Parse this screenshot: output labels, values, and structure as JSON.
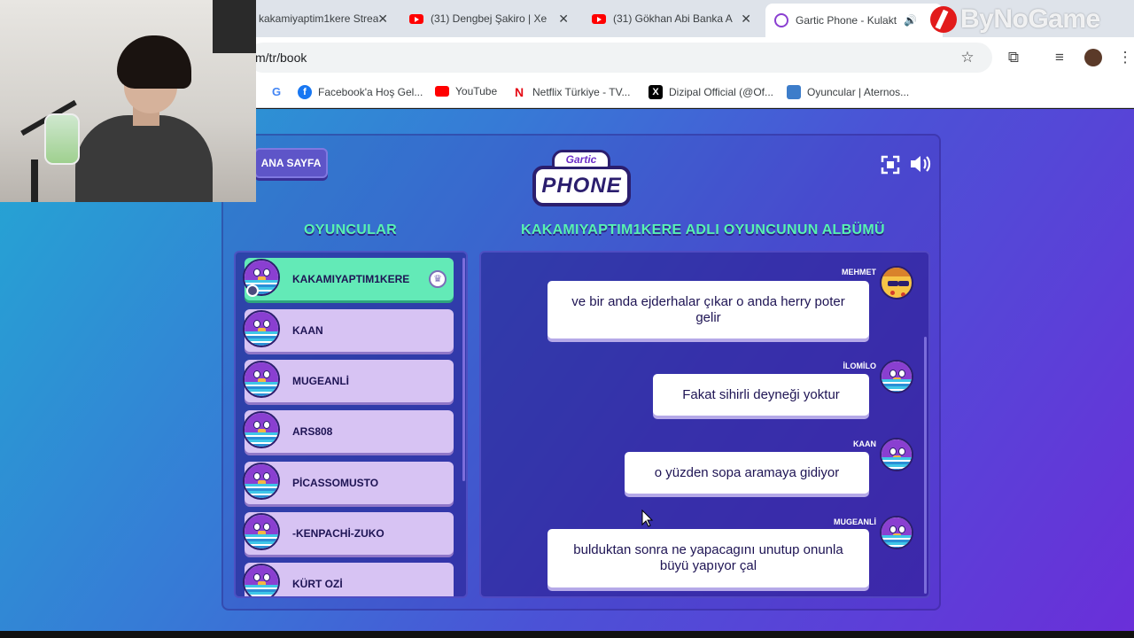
{
  "browser": {
    "tabs": [
      {
        "title": "kakamiyaptim1kere Strea",
        "type": "stream"
      },
      {
        "title": "(31) Dengbej Şakiro | Xe",
        "type": "youtube"
      },
      {
        "title": "(31) Gökhan Abi Banka A",
        "type": "youtube"
      },
      {
        "title": "Gartic Phone - Kulakt",
        "type": "active"
      }
    ],
    "close_glyph": "✕",
    "url": "m/tr/book",
    "bookmarks": [
      {
        "label": "Facebook'a Hoş Gel...",
        "icon": "facebook-icon",
        "color": "#1877f2"
      },
      {
        "label": "YouTube",
        "icon": "youtube-icon",
        "color": "#ff0000"
      },
      {
        "label": "Netflix Türkiye - TV...",
        "icon": "netflix-icon",
        "color": "#e50914"
      },
      {
        "label": "Dizipal Official (@Of...",
        "icon": "x-icon",
        "color": "#000000"
      },
      {
        "label": "Oyuncular | Aternos...",
        "icon": "aternos-icon",
        "color": "#3d7dca"
      }
    ]
  },
  "watermark": "ByNoGame",
  "game": {
    "home_button": "ANA SAYFA",
    "logo_top": "Gartic",
    "logo_main": "PHONE",
    "players_title": "OYUNCULAR",
    "album_title": "KAKAMIYAPTIM1KERE ADLI OYUNCUNUN ALBÜMÜ",
    "players": [
      {
        "name": "KAKAMIYAPTIM1KERE",
        "is_host": true
      },
      {
        "name": "KAAN"
      },
      {
        "name": "MUGEANLİ"
      },
      {
        "name": "ARS808"
      },
      {
        "name": "PİCASSOMUSTO"
      },
      {
        "name": "-KENPACHİ-ZUKO"
      },
      {
        "name": "KÜRT OZİ"
      }
    ],
    "album": [
      {
        "author": "MEHMET",
        "text": "ve bir anda ejderhalar çıkar o anda herry poter gelir",
        "avatar": "pizza"
      },
      {
        "author": "İLOMİLO",
        "text": "Fakat sihirli deyneği yoktur",
        "avatar": "bird"
      },
      {
        "author": "KAAN",
        "text": "o yüzden sopa aramaya gidiyor",
        "avatar": "bird"
      },
      {
        "author": "MUGEANLİ",
        "text": "bulduktan sonra ne yapacagını unutup onunla büyü yapıyor çal",
        "avatar": "bird"
      }
    ]
  },
  "colors": {
    "accent_green": "#57f2b1",
    "player_card": "#d7c3f3",
    "host_card": "#63eab7",
    "panel_dark": "#2b1e6e"
  }
}
